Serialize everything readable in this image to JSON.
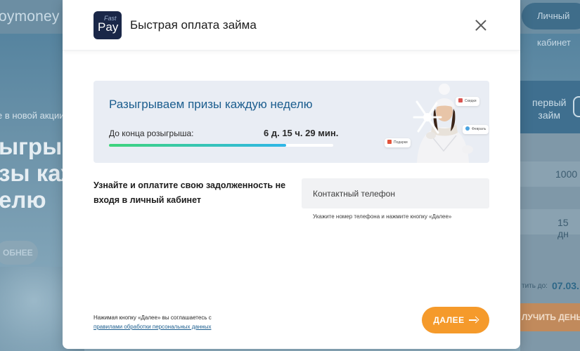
{
  "background": {
    "logo_text": "oymoney",
    "cabinet_button": "Личный кабинет",
    "promo_subtitle": "е в новой акции",
    "headline_lines": [
      "ыгрыв",
      "зы каж",
      "елю"
    ],
    "more_button": "ОБНЕЕ",
    "first_loan_lines": [
      "первый",
      "займ"
    ],
    "amount": "1000",
    "term": "15 дн",
    "pay_label": "тить до:",
    "pay_date": "07.03.",
    "get_money_button": "ЛУЧИТЬ ДЕНЬ"
  },
  "modal": {
    "logo": {
      "fast": "Fast",
      "pay": "Pay"
    },
    "title": "Быстрая оплата займа",
    "close_icon": "close-icon",
    "promo": {
      "title": "Разыгрываем призы каждую неделю",
      "timer_label": "До конца розыгрыша:",
      "timer_value": "6 д. 15 ч. 29 мин.",
      "progress_fraction": 0.79,
      "chips": [
        "Скидки",
        "Февраль",
        "Подарки"
      ]
    },
    "lookup_text": "Узнайте и оплатите свою задолженность не входя в личный кабинет",
    "phone": {
      "placeholder": "Контактный телефон",
      "value": ""
    },
    "phone_hint": "Укажите номер телефона и нажмите кнопку «Далее»",
    "consent_text": "Нажимая кнопку «Далее» вы соглашаетесь с",
    "consent_link": "правилами обработки персональных данных",
    "next_button": "ДАЛЕЕ"
  },
  "colors": {
    "accent_orange": "#f59a2b",
    "brand_blue": "#1b5d8e",
    "logo_navy": "#1a2748"
  }
}
